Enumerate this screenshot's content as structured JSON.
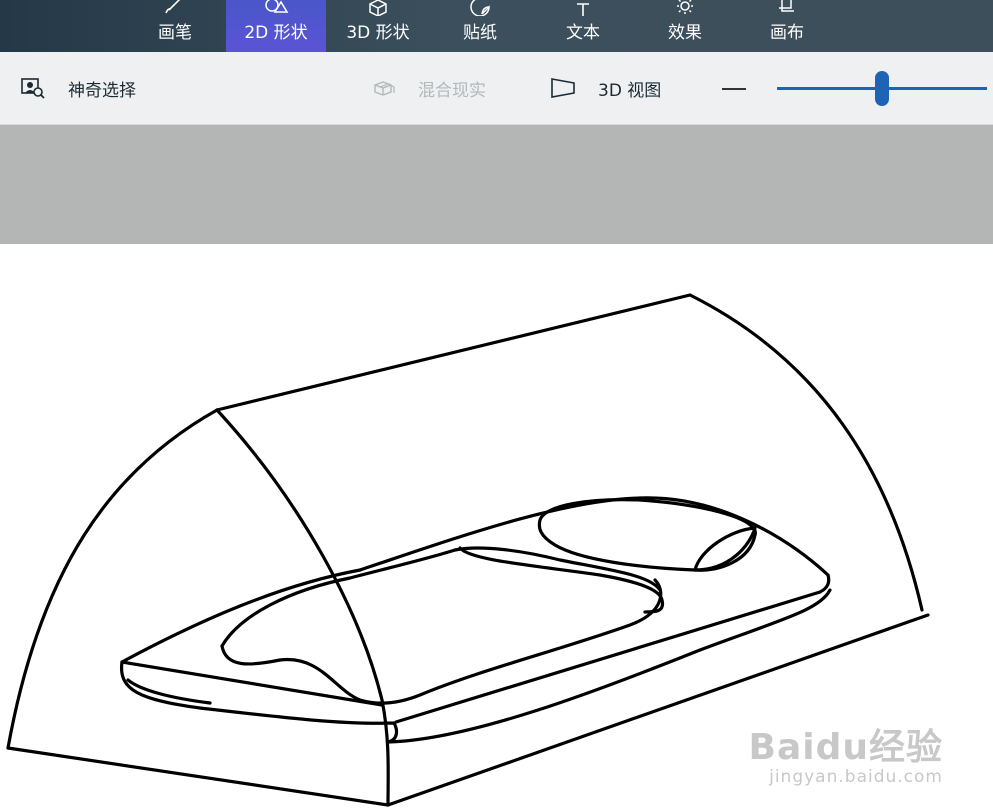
{
  "ribbon": {
    "tabs": [
      {
        "label": "画笔",
        "icon": "brush-icon",
        "active": false
      },
      {
        "label": "2D 形状",
        "icon": "2d-shapes-icon",
        "active": true
      },
      {
        "label": "3D 形状",
        "icon": "3d-cube-icon",
        "active": false
      },
      {
        "label": "贴纸",
        "icon": "sticker-icon",
        "active": false
      },
      {
        "label": "文本",
        "icon": "text-icon",
        "active": false
      },
      {
        "label": "效果",
        "icon": "sun-effects-icon",
        "active": false
      },
      {
        "label": "画布",
        "icon": "canvas-crop-icon",
        "active": false
      }
    ],
    "active_color": "#5b54d6"
  },
  "toolbar": {
    "magic_select": {
      "label": "神奇选择",
      "icon": "magic-select-icon"
    },
    "mixed_reality": {
      "label": "混合现实",
      "icon": "mixed-reality-icon",
      "enabled": false
    },
    "view_3d": {
      "label": "3D 视图",
      "icon": "3d-view-icon"
    },
    "zoom": {
      "minus_icon": "minus-icon",
      "level": 0.47
    }
  },
  "watermark": {
    "logo": "Baidu经验",
    "sub": "jingyan.baidu.com"
  }
}
